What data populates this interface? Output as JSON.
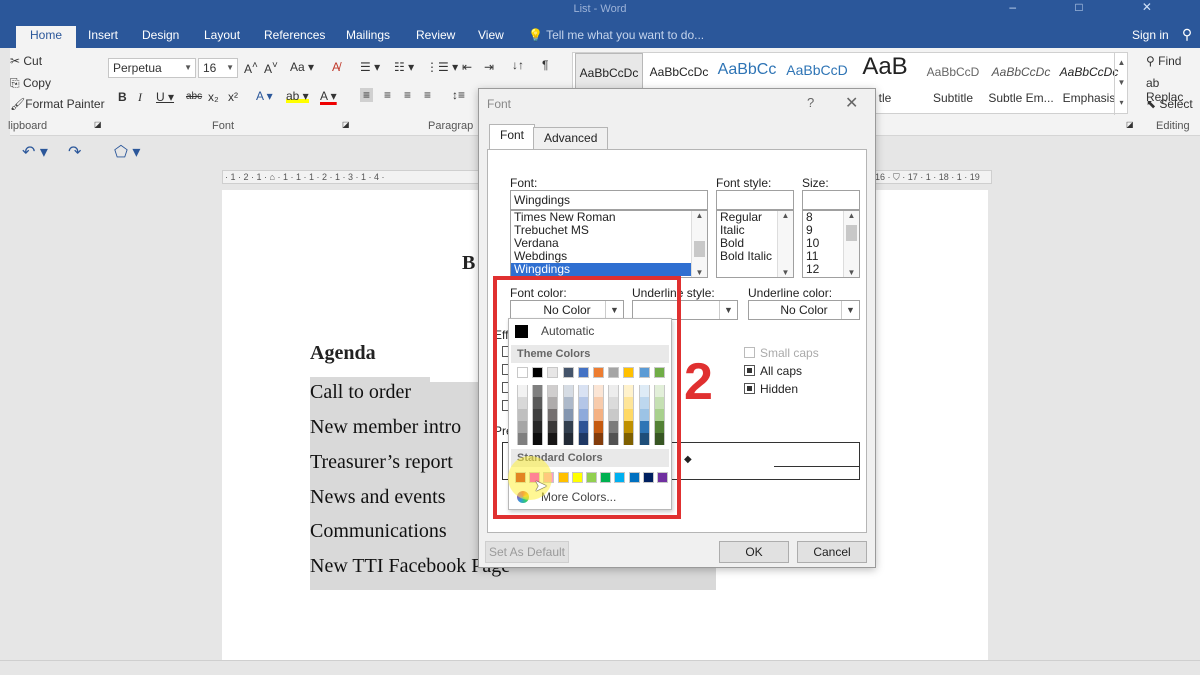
{
  "window": {
    "title": "List - Word",
    "controls": "–  □  ✕"
  },
  "ribbon_tabs": [
    "Home",
    "Insert",
    "Design",
    "Layout",
    "References",
    "Mailings",
    "Review",
    "View"
  ],
  "tell_me": "Tell me what you want to do...",
  "sign_in": "Sign in",
  "clipboard": {
    "cut": "Cut",
    "copy": "Copy",
    "format_painter": "Format Painter",
    "label": "lipboard"
  },
  "font_group": {
    "font_name": "Perpetua",
    "font_size": "16",
    "label": "Font"
  },
  "paragraph_group": {
    "label": "Paragrap"
  },
  "styles": [
    {
      "sample": "AaBbCcDc",
      "name": ""
    },
    {
      "sample": "AaBbCcDc",
      "name": ""
    },
    {
      "sample": "AaBbCc",
      "name": ""
    },
    {
      "sample": "AaBbCcD",
      "name": ""
    },
    {
      "sample": "AaB",
      "name": "tle"
    },
    {
      "sample": "AaBbCcD",
      "name": "Subtitle"
    },
    {
      "sample": "AaBbCcDc",
      "name": "Subtle Em..."
    },
    {
      "sample": "AaBbCcDc",
      "name": "Emphasis"
    }
  ],
  "editing": {
    "find": "Find",
    "replace": "Replac",
    "select": "Select",
    "label": "Editing"
  },
  "ruler": {
    "left": "· 1 · 2 · 1 · ⌂ · 1 · 1 · 1 · 2 · 1 · 3 · 1 · 4 ·",
    "right": "16 · ⛉ · 17 · 1 · 18 · 1 · 19"
  },
  "document": {
    "heading": "B",
    "agenda": "Agenda",
    "lines": [
      "Call to order",
      "New member intro",
      "Treasurer’s report",
      "News and events",
      "Communications",
      "New TTI Facebook Page"
    ]
  },
  "dialog": {
    "title": "Font",
    "help": "?",
    "close": "✕",
    "tabs": [
      "Font",
      "Advanced"
    ],
    "font_label": "Font:",
    "font_value": "Wingdings",
    "font_list": [
      "Times New Roman",
      "Trebuchet MS",
      "Verdana",
      "Webdings",
      "Wingdings"
    ],
    "style_label": "Font style:",
    "style_value": "",
    "style_list": [
      "Regular",
      "Italic",
      "Bold",
      "Bold Italic"
    ],
    "size_label": "Size:",
    "size_value": "",
    "size_list": [
      "8",
      "9",
      "10",
      "11",
      "12"
    ],
    "font_color_label": "Font color:",
    "font_color_value": "No Color",
    "underline_style_label": "Underline style:",
    "underline_color_label": "Underline color:",
    "underline_color_value": "No Color",
    "effects_label": "Effe",
    "effects": [
      {
        "label": "Small caps",
        "state": "disabled"
      },
      {
        "label": "All caps",
        "state": "checked"
      },
      {
        "label": "Hidden",
        "state": "checked"
      }
    ],
    "preview_label": "Pre",
    "set_default": "Set As Default",
    "ok": "OK",
    "cancel": "Cancel"
  },
  "color_popup": {
    "automatic": "Automatic",
    "theme_colors": "Theme Colors",
    "standard_colors": "Standard Colors",
    "more_colors": "More Colors...",
    "theme_top": [
      "#ffffff",
      "#000000",
      "#e7e6e6",
      "#44546a",
      "#4472c4",
      "#ed7d31",
      "#a5a5a5",
      "#ffc000",
      "#5b9bd5",
      "#70ad47"
    ],
    "theme_shades": [
      [
        "#f2f2f2",
        "#7f7f7f",
        "#d0cece",
        "#d6dce4",
        "#d9e2f3",
        "#fbe5d5",
        "#ededed",
        "#fff2cc",
        "#deebf6",
        "#e2efd9"
      ],
      [
        "#d8d8d8",
        "#595959",
        "#aeabab",
        "#adb9ca",
        "#b4c6e7",
        "#f7cbac",
        "#dbdbdb",
        "#fee599",
        "#bdd7ee",
        "#c5e0b3"
      ],
      [
        "#bfbfbf",
        "#3f3f3f",
        "#757070",
        "#8496b0",
        "#8eaadb",
        "#f4b183",
        "#c9c9c9",
        "#ffd965",
        "#9cc3e5",
        "#a8d08d"
      ],
      [
        "#a5a5a5",
        "#262626",
        "#3a3838",
        "#323f4f",
        "#2f5496",
        "#c55a11",
        "#7b7b7b",
        "#bf9000",
        "#2e75b5",
        "#538135"
      ],
      [
        "#7f7f7f",
        "#0c0c0c",
        "#171616",
        "#222a35",
        "#1f3864",
        "#833c0b",
        "#525252",
        "#7f6000",
        "#1e4e79",
        "#375623"
      ]
    ],
    "standard": [
      "#c00000",
      "#ff00ff",
      "#ff99cc",
      "#ffc000",
      "#ffff00",
      "#92d050",
      "#00b050",
      "#00b0f0",
      "#0070c0",
      "#002060",
      "#7030a0"
    ]
  },
  "annotation": {
    "step": "2",
    "color": "#e03030"
  }
}
